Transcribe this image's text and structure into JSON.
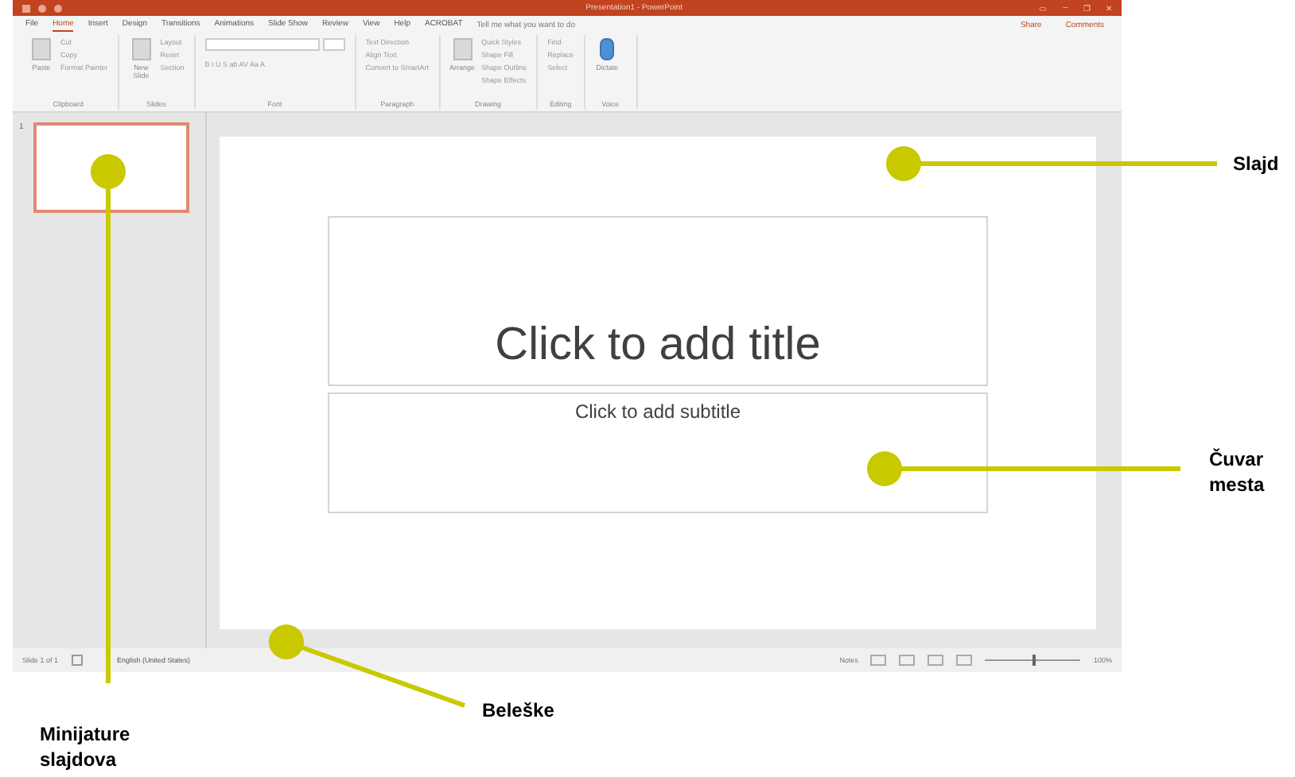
{
  "window": {
    "title": "Presentation1 - PowerPoint",
    "controls": [
      "▭",
      "–",
      "❐",
      "✕"
    ]
  },
  "tabs": [
    {
      "label": "File",
      "selected": false
    },
    {
      "label": "Home",
      "selected": true
    },
    {
      "label": "Insert",
      "selected": false
    },
    {
      "label": "Design",
      "selected": false
    },
    {
      "label": "Transitions",
      "selected": false
    },
    {
      "label": "Animations",
      "selected": false
    },
    {
      "label": "Slide Show",
      "selected": false
    },
    {
      "label": "Review",
      "selected": false
    },
    {
      "label": "View",
      "selected": false
    },
    {
      "label": "Help",
      "selected": false
    },
    {
      "label": "ACROBAT",
      "selected": false
    }
  ],
  "tell_me": {
    "placeholder": "Tell me what you want to do"
  },
  "header_buttons": [
    "Share",
    "Comments"
  ],
  "ribbon_groups": [
    {
      "name": "Clipboard",
      "big": "Paste",
      "items": [
        "Cut",
        "Copy",
        "Format Painter"
      ]
    },
    {
      "name": "Slides",
      "big": "New Slide",
      "items": [
        "Layout",
        "Reset",
        "Section"
      ]
    },
    {
      "name": "Font",
      "items": [
        "B I U S ab AV Aa A"
      ]
    },
    {
      "name": "Paragraph",
      "items": [
        "Text Direction",
        "Align Text",
        "Convert to SmartArt"
      ]
    },
    {
      "name": "Drawing",
      "big": "Arrange",
      "items": [
        "Quick Styles",
        "Shape Fill",
        "Shape Outline",
        "Shape Effects"
      ]
    },
    {
      "name": "Editing",
      "items": [
        "Find",
        "Replace",
        "Select"
      ]
    },
    {
      "name": "Voice",
      "big": "Dictate"
    }
  ],
  "thumbnails": [
    {
      "number": "1",
      "selected": true
    }
  ],
  "slide": {
    "title_placeholder": "Click to add title",
    "subtitle_placeholder": "Click to add subtitle"
  },
  "status_bar": {
    "slide_count": "Slide 1 of 1",
    "language": "English (United States)",
    "notes": "Notes",
    "zoom": "100%",
    "zoom_slider": {
      "level": 0.5
    }
  },
  "callouts": [
    {
      "label": "Slajd"
    },
    {
      "label": "Čuvar mesta"
    },
    {
      "label": "Beleške"
    },
    {
      "label": "Minijature slajdova"
    }
  ]
}
